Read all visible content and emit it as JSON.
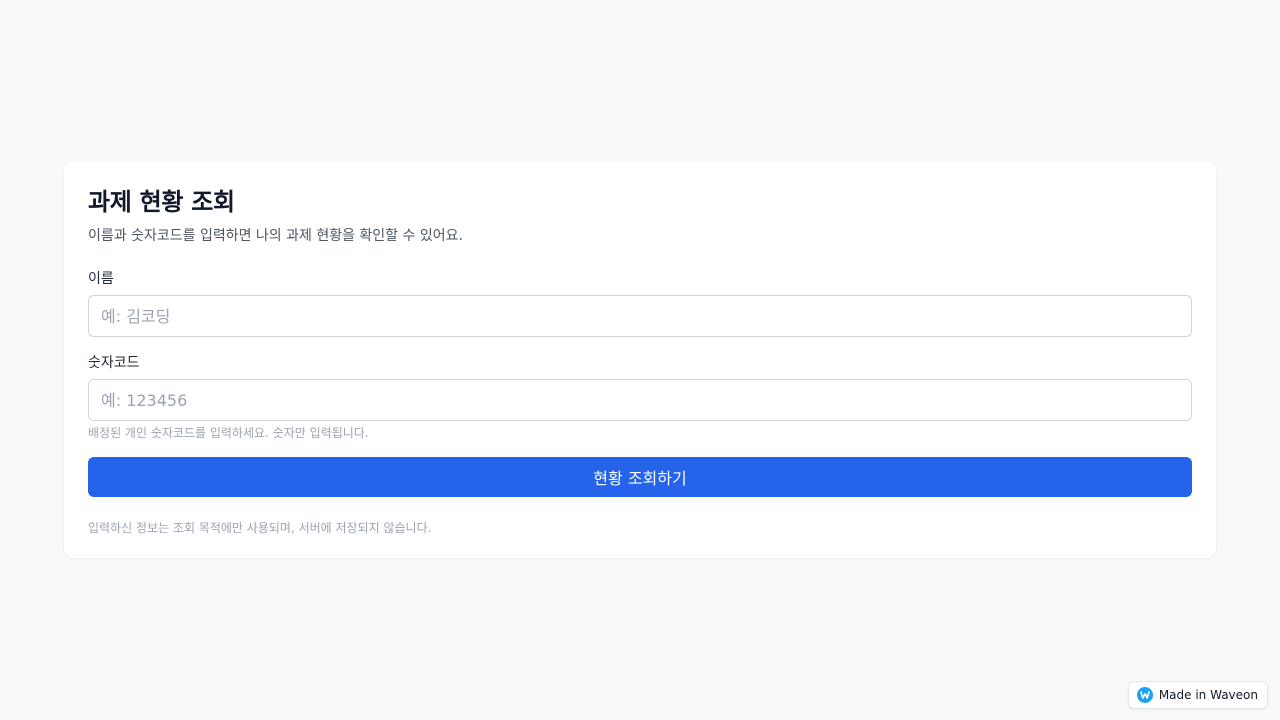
{
  "form": {
    "title": "과제 현황 조회",
    "subtitle": "이름과 숫자코드를 입력하면 나의 과제 현황을 확인할 수 있어요.",
    "name_label": "이름",
    "name_placeholder": "예: 김코딩",
    "name_value": "",
    "code_label": "숫자코드",
    "code_placeholder": "예: 123456",
    "code_value": "",
    "code_hint": "배정된 개인 숫자코드를 입력하세요. 숫자만 입력됩니다.",
    "submit_label": "현황 조회하기",
    "privacy_note": "입력하신 정보는 조회 목적에만 사용되며, 서버에 저장되지 않습니다."
  },
  "badge": {
    "label": "Made in Waveon",
    "icon": "waveon-logo-icon"
  },
  "colors": {
    "background": "#f8f9fb",
    "accent": "#2563eb",
    "badge_logo": "#1ea1f2"
  }
}
